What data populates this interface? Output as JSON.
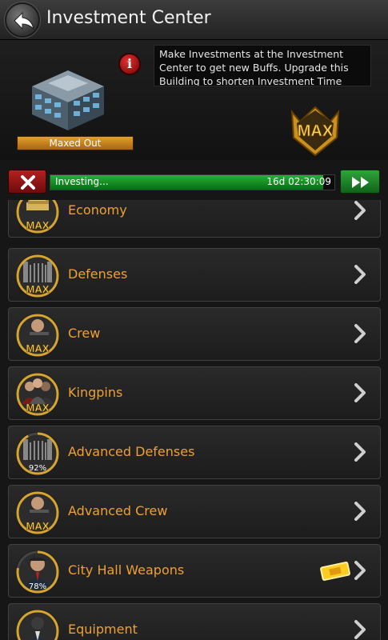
{
  "header": {
    "title": "Investment Center"
  },
  "info": {
    "status_label": "Maxed Out",
    "description": "Make Investments at the Investment Center to get new Buffs. Upgrade this Building to shorten Investment Time",
    "max_badge": "MAX"
  },
  "progress": {
    "label": "Investing...",
    "time_remaining": "16d 02:30:09",
    "fraction": 0.96
  },
  "colors": {
    "accent": "#f0a030",
    "progress": "#22b432",
    "cancel": "#b52020"
  },
  "items": [
    {
      "label": "Economy",
      "badge": "MAX",
      "icon": "money-icon"
    },
    {
      "label": "Defenses",
      "badge": "MAX",
      "icon": "gate-icon"
    },
    {
      "label": "Crew",
      "badge": "MAX",
      "icon": "crew-icon"
    },
    {
      "label": "Kingpins",
      "badge": "MAX",
      "icon": "kingpins-icon"
    },
    {
      "label": "Advanced Defenses",
      "badge": "92%",
      "icon": "gate-icon",
      "progress": 0.92
    },
    {
      "label": "Advanced Crew",
      "badge": "MAX",
      "icon": "crew-icon"
    },
    {
      "label": "City Hall Weapons",
      "badge": "78%",
      "icon": "gangster-icon",
      "progress": 0.78,
      "ticket": "ticket-icon"
    },
    {
      "label": "Equipment",
      "badge": "",
      "icon": "suit-icon"
    }
  ]
}
